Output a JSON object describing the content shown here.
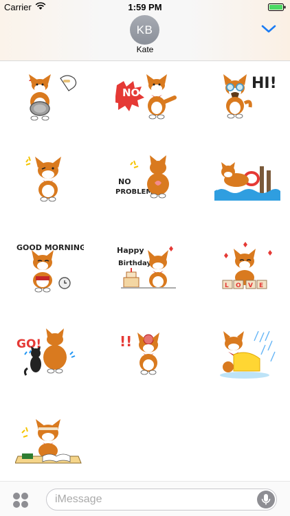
{
  "status_bar": {
    "carrier": "Carrier",
    "time": "1:59 PM",
    "wifi_icon": "wifi-icon",
    "battery_icon": "battery-icon",
    "battery_color": "#4cd964"
  },
  "header": {
    "avatar_initials": "KB",
    "contact_name": "Kate",
    "chevron_icon": "chevron-down-icon",
    "accent_color": "#1a7cf4"
  },
  "stickers": [
    {
      "name": "corgi-food-bowl",
      "caption": ""
    },
    {
      "name": "corgi-no",
      "caption": "NO"
    },
    {
      "name": "corgi-hi",
      "caption": "HI!"
    },
    {
      "name": "corgi-wink",
      "caption": ""
    },
    {
      "name": "corgi-no-problem",
      "caption": "NO PROBLEM"
    },
    {
      "name": "corgi-swimming",
      "caption": ""
    },
    {
      "name": "corgi-good-morning",
      "caption": "GOOD MORNING"
    },
    {
      "name": "corgi-happy-birthday",
      "caption": "Happy Birthday"
    },
    {
      "name": "corgi-love",
      "caption": "LOVE"
    },
    {
      "name": "corgi-go",
      "caption": "GO!"
    },
    {
      "name": "corgi-exclaim",
      "caption": "!!"
    },
    {
      "name": "corgi-raincoat",
      "caption": ""
    },
    {
      "name": "corgi-studying",
      "caption": ""
    }
  ],
  "footer": {
    "apps_icon": "app-drawer-icon",
    "input_placeholder": "iMessage",
    "mic_icon": "microphone-icon"
  }
}
